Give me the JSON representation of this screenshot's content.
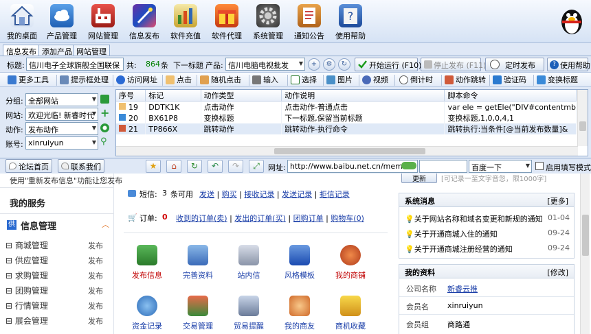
{
  "toolbar": {
    "items": [
      {
        "label": "我的桌面",
        "icon": "house-icon"
      },
      {
        "label": "产品管理",
        "icon": "cloud-icon"
      },
      {
        "label": "网站管理",
        "icon": "factory-icon"
      },
      {
        "label": "信息发布",
        "icon": "magic-wand-icon"
      },
      {
        "label": "软件充值",
        "icon": "bar-chart-icon"
      },
      {
        "label": "软件代理",
        "icon": "gift-box-icon"
      },
      {
        "label": "系统管理",
        "icon": "gear-icon"
      },
      {
        "label": "通知公告",
        "icon": "notebook-icon"
      },
      {
        "label": "使用帮助",
        "icon": "help-book-icon"
      }
    ]
  },
  "tabs": [
    "信息发布",
    "添加产品",
    "网站管理"
  ],
  "title_row": {
    "title_label": "标题:",
    "title_value": "信川电子全球旗舰全国联保",
    "total_label": "共:",
    "total_count": "864",
    "total_unit": "条",
    "next_title": "下一标题",
    "product_label": "产品:",
    "product_value": "信川电脑电视批发",
    "start_btn": "开始运行 (F10)",
    "stop_btn": "停止发布 (F11)",
    "timer_btn": "定时发布",
    "help_btn": "使用帮助"
  },
  "tools": [
    "更多工具",
    "提示框处理",
    "访问网址",
    "点击",
    "随机点击",
    "输入",
    "选择",
    "图片",
    "视频",
    "倒计时",
    "动作跳转",
    "验证码",
    "变换标题"
  ],
  "filters": {
    "group_label": "分组:",
    "group_value": "全部网站",
    "site_label": "网站:",
    "site_value": "欢迎光临! 新睿时代",
    "action_label": "动作:",
    "action_value": "发布动作",
    "account_label": "账号:",
    "account_value": "xinruiyun"
  },
  "grid": {
    "columns": [
      "序号",
      "标记",
      "动作类型",
      "动作说明",
      "脚本命令"
    ],
    "rows": [
      {
        "no": "19",
        "mark": "DDTK1K",
        "type": "点击动作",
        "desc": "点击动作-普通点击",
        "cmd": "var ele = getEle(\"DIV#contentmb"
      },
      {
        "no": "20",
        "mark": "BX61P8",
        "type": "变换标题",
        "desc": "下一标题,保留当前标题",
        "cmd": "变换标题,1,0,0,4,1"
      },
      {
        "no": "21",
        "mark": "TP866X",
        "type": "跳转动作",
        "desc": "跳转动作-执行命令",
        "cmd": "跳转执行:当条件[@当前发布数量]&"
      }
    ]
  },
  "nav": {
    "forum_btn": "论坛首页",
    "contact_btn": "联系我们",
    "url_label": "网址:",
    "url_value": "http://www.baibu.net.cn/membe",
    "search_engine": "百度一下",
    "autofill_label": "启用填写模式"
  },
  "page": {
    "notice_text": "使用\"重新发布信息\"功能让您发布",
    "my_services": "我的服务",
    "info_mgmt": "信息管理",
    "menu": [
      {
        "label": "商城管理",
        "action": "发布"
      },
      {
        "label": "供应管理",
        "action": "发布"
      },
      {
        "label": "求购管理",
        "action": "发布"
      },
      {
        "label": "团购管理",
        "action": "发布"
      },
      {
        "label": "行情管理",
        "action": "发布"
      },
      {
        "label": "展会管理",
        "action": "发布"
      }
    ],
    "sms_label": "短信:",
    "sms_count": "3",
    "sms_unit": "条可用",
    "sms_links": [
      "发送",
      "购买",
      "接收记录",
      "发送记录",
      "拒信记录"
    ],
    "order_label": "订单:",
    "order_count": "0",
    "order_links": [
      "收到的订单(卖)",
      "发出的订单(买)",
      "团购订单",
      "购物车(0)"
    ],
    "icons_row1": [
      {
        "label": "发布信息",
        "icon": "person-post-icon",
        "color": "#c00000"
      },
      {
        "label": "完善资料",
        "icon": "edit-profile-icon",
        "color": "#1a3ea8"
      },
      {
        "label": "站内信",
        "icon": "mail-stack-icon",
        "color": "#1a3ea8"
      },
      {
        "label": "风格模板",
        "icon": "template-window-icon",
        "color": "#1a3ea8"
      },
      {
        "label": "我的商铺",
        "icon": "shop-globe-icon",
        "color": "#c00000"
      }
    ],
    "icons_row2": [
      {
        "label": "资金记录",
        "icon": "money-record-icon",
        "color": "#1a3ea8"
      },
      {
        "label": "交易管理",
        "icon": "trade-icon",
        "color": "#1a3ea8"
      },
      {
        "label": "贸易提醒",
        "icon": "reminder-icon",
        "color": "#1a3ea8"
      },
      {
        "label": "我的商友",
        "icon": "friends-icon",
        "color": "#1a3ea8"
      },
      {
        "label": "商机收藏",
        "icon": "favorites-icon",
        "color": "#1a3ea8"
      }
    ],
    "search_top_text": "[可记录一至文字音忽，限1000字]",
    "system_msg_title": "系统消息",
    "more": "[更多]",
    "messages": [
      {
        "text": "关于网站名称和域名变更和新规的通知",
        "date": "01-04"
      },
      {
        "text": "关于开通商城入住的通知",
        "date": "09-24"
      },
      {
        "text": "关于开通商城注册经营的通知",
        "date": "09-24"
      }
    ],
    "profile_title": "我的资料",
    "edit": "[修改]",
    "profile": [
      {
        "label": "公司名称",
        "value": "新睿云推"
      },
      {
        "label": "会员名",
        "value": "xinruiyun"
      },
      {
        "label": "会员组",
        "value": "商路通"
      }
    ]
  }
}
